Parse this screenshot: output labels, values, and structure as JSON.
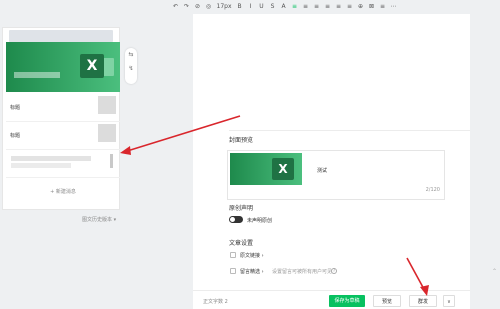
{
  "toolbar": {
    "items": [
      "↶",
      "↷",
      "⊘",
      "◎",
      "17px",
      "B",
      "I",
      "U",
      "S",
      "A",
      "≡",
      "≡",
      "≡",
      "≡",
      "≡",
      "≡",
      "⊕",
      "⊠",
      "≡",
      "⋯"
    ],
    "font_size": "17px"
  },
  "left": {
    "items": [
      {
        "title": "标题"
      },
      {
        "title": "标题"
      }
    ],
    "new_message": "+ 新建消息",
    "history": "图文历史版本 ▾",
    "side_icons": [
      "⇆",
      "↯"
    ]
  },
  "editor": {
    "cover_label": "封面预览",
    "cover_text": "测试",
    "cover_count": "2/120",
    "original_label": "原创声明",
    "original_toggle": "未声明原创",
    "article_settings": "文章设置",
    "option1": "原文链接 ›",
    "option2": "留言精选 ›",
    "option2_note": "设置留言可被所有用户可见"
  },
  "bottom": {
    "word_count": "正文字数 2",
    "save": "保存为草稿",
    "preview": "预览",
    "publish": "群发",
    "more": "∨"
  },
  "colors": {
    "accent": "#07c160",
    "arrow": "#d9262c"
  }
}
